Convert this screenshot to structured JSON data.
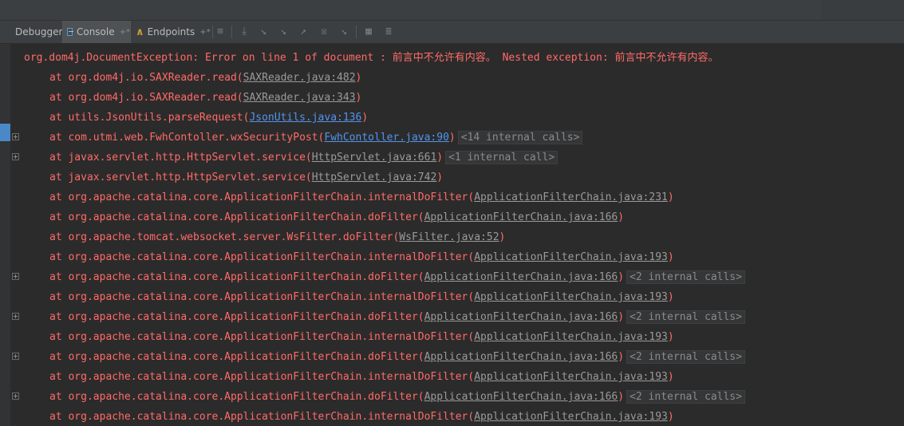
{
  "toolbar": {
    "tabs": [
      {
        "label": "Debugger"
      },
      {
        "label": "Console",
        "pin": "+*"
      },
      {
        "label": "Endpoints",
        "pin": "+*"
      }
    ],
    "icons": [
      "show-execution-point-icon",
      "step-over-icon",
      "step-into-icon",
      "force-step-into-icon",
      "step-out-icon",
      "drop-frame-icon",
      "run-to-cursor-icon",
      "evaluate-expression-icon",
      "trace-icon"
    ]
  },
  "console": {
    "lines": [
      {
        "prefix": "org.dom4j.DocumentException: Error on line 1 of document  : 前言中不允许有内容。 Nested exception: 前言中不允许有内容。",
        "link": "",
        "suffix": "",
        "calls": ""
      },
      {
        "prefix": "at org.dom4j.io.SAXReader.read(",
        "link": "SAXReader.java:482",
        "suffix": ")",
        "calls": ""
      },
      {
        "prefix": "at org.dom4j.io.SAXReader.read(",
        "link": "SAXReader.java:343",
        "suffix": ")",
        "calls": ""
      },
      {
        "prefix": "at utils.JsonUtils.parseRequest(",
        "link": "JsonUtils.java:136",
        "suffix": ")",
        "calls": ""
      },
      {
        "prefix": "at com.utmi.web.FwhContoller.wxSecurityPost(",
        "link": "FwhContoller.java:90",
        "suffix": ")",
        "calls": "<14 internal calls>"
      },
      {
        "prefix": "at javax.servlet.http.HttpServlet.service(",
        "link": "HttpServlet.java:661",
        "suffix": ")",
        "calls": "<1 internal call>"
      },
      {
        "prefix": "at javax.servlet.http.HttpServlet.service(",
        "link": "HttpServlet.java:742",
        "suffix": ")",
        "calls": ""
      },
      {
        "prefix": "at org.apache.catalina.core.ApplicationFilterChain.internalDoFilter(",
        "link": "ApplicationFilterChain.java:231",
        "suffix": ")",
        "calls": ""
      },
      {
        "prefix": "at org.apache.catalina.core.ApplicationFilterChain.doFilter(",
        "link": "ApplicationFilterChain.java:166",
        "suffix": ")",
        "calls": ""
      },
      {
        "prefix": "at org.apache.tomcat.websocket.server.WsFilter.doFilter(",
        "link": "WsFilter.java:52",
        "suffix": ")",
        "calls": ""
      },
      {
        "prefix": "at org.apache.catalina.core.ApplicationFilterChain.internalDoFilter(",
        "link": "ApplicationFilterChain.java:193",
        "suffix": ")",
        "calls": ""
      },
      {
        "prefix": "at org.apache.catalina.core.ApplicationFilterChain.doFilter(",
        "link": "ApplicationFilterChain.java:166",
        "suffix": ")",
        "calls": "<2 internal calls>"
      },
      {
        "prefix": "at org.apache.catalina.core.ApplicationFilterChain.internalDoFilter(",
        "link": "ApplicationFilterChain.java:193",
        "suffix": ")",
        "calls": ""
      },
      {
        "prefix": "at org.apache.catalina.core.ApplicationFilterChain.doFilter(",
        "link": "ApplicationFilterChain.java:166",
        "suffix": ")",
        "calls": "<2 internal calls>"
      },
      {
        "prefix": "at org.apache.catalina.core.ApplicationFilterChain.internalDoFilter(",
        "link": "ApplicationFilterChain.java:193",
        "suffix": ")",
        "calls": ""
      },
      {
        "prefix": "at org.apache.catalina.core.ApplicationFilterChain.doFilter(",
        "link": "ApplicationFilterChain.java:166",
        "suffix": ")",
        "calls": "<2 internal calls>"
      },
      {
        "prefix": "at org.apache.catalina.core.ApplicationFilterChain.internalDoFilter(",
        "link": "ApplicationFilterChain.java:193",
        "suffix": ")",
        "calls": ""
      },
      {
        "prefix": "at org.apache.catalina.core.ApplicationFilterChain.doFilter(",
        "link": "ApplicationFilterChain.java:166",
        "suffix": ")",
        "calls": "<2 internal calls>"
      },
      {
        "prefix": "at org.apache.catalina.core.ApplicationFilterChain.internalDoFilter(",
        "link": "ApplicationFilterChain.java:193",
        "suffix": ")",
        "calls": ""
      }
    ]
  },
  "colors": {
    "error_text": "#ff6b68",
    "link_gray": "#9a9a9a",
    "link_blue": "#5394ec",
    "background": "#2b2b2b"
  }
}
